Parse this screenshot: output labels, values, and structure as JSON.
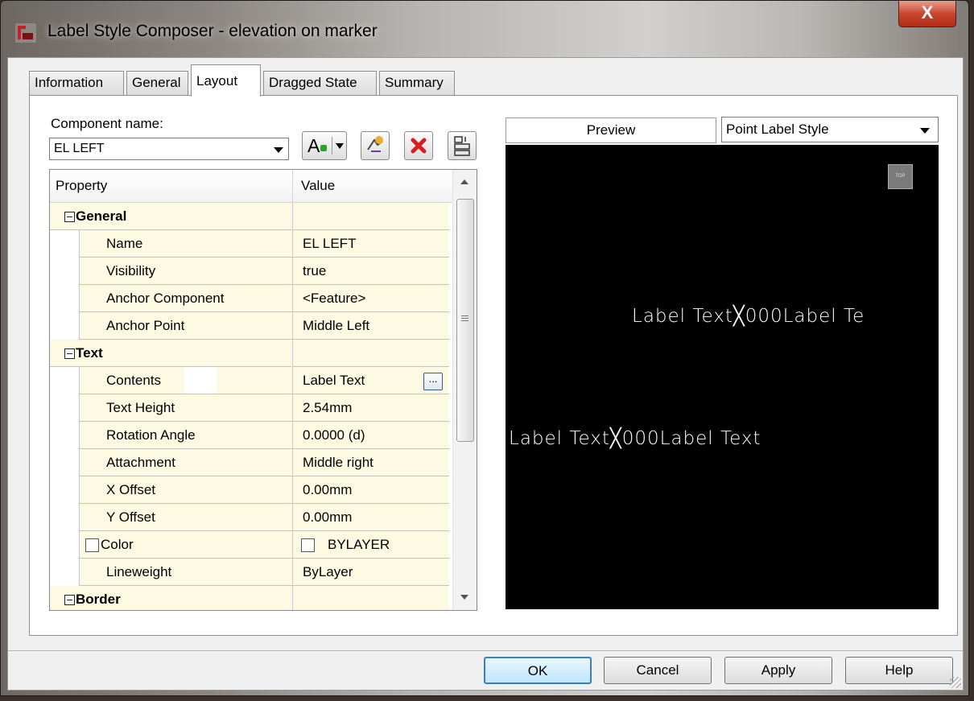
{
  "window": {
    "title": "Label Style Composer - elevation on marker",
    "close_label": "X"
  },
  "tabs": [
    {
      "label": "Information"
    },
    {
      "label": "General"
    },
    {
      "label": "Layout",
      "active": true
    },
    {
      "label": "Dragged State"
    },
    {
      "label": "Summary"
    }
  ],
  "component": {
    "label": "Component name:",
    "value": "EL LEFT"
  },
  "toolbar": {
    "text_tool_label": "A"
  },
  "grid": {
    "header": {
      "property": "Property",
      "value": "Value"
    },
    "sections": [
      {
        "title": "General",
        "rows": [
          {
            "property": "Name",
            "value": "EL LEFT"
          },
          {
            "property": "Visibility",
            "value": "true"
          },
          {
            "property": "Anchor Component",
            "value": "<Feature>"
          },
          {
            "property": "Anchor Point",
            "value": "Middle Left"
          }
        ]
      },
      {
        "title": "Text",
        "rows": [
          {
            "property": "Contents",
            "value": "Label Text"
          },
          {
            "property": "Text Height",
            "value": "2.54mm"
          },
          {
            "property": "Rotation Angle",
            "value": "0.0000 (d)"
          },
          {
            "property": "Attachment",
            "value": "Middle right"
          },
          {
            "property": "X Offset",
            "value": "0.00mm"
          },
          {
            "property": "Y Offset",
            "value": "0.00mm"
          },
          {
            "property": "Color",
            "value": "BYLAYER"
          },
          {
            "property": "Lineweight",
            "value": "ByLayer"
          }
        ]
      },
      {
        "title": "Border",
        "rows": []
      }
    ],
    "ellipsis_label": "..."
  },
  "preview": {
    "header": "Preview",
    "style_select": "Point Label Style",
    "top_badge": "TOP",
    "label_line_1": "Label Text╳000Label Te",
    "label_line_2": "Label Text╳000Label Text"
  },
  "buttons": {
    "ok": "OK",
    "cancel": "Cancel",
    "apply": "Apply",
    "help": "Help"
  },
  "colors": {
    "accent": "#3c7fb1",
    "close": "#c9462f",
    "grid_bg": "#fdfae3",
    "grid_line": "#c8b8f0",
    "preview_bg": "#000000"
  }
}
